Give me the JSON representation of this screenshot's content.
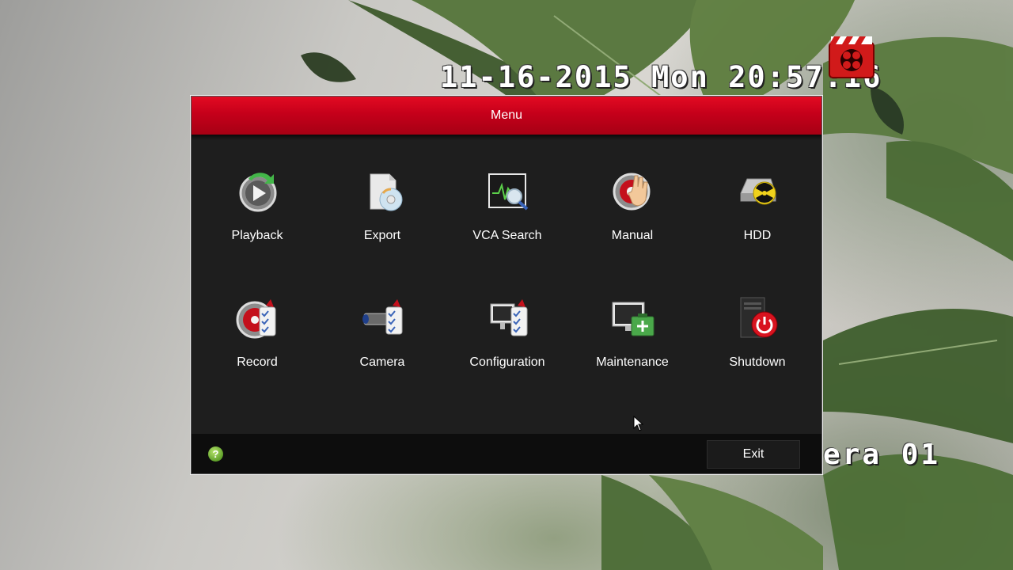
{
  "osd": {
    "datetime": "11-16-2015 Mon 20:57:16",
    "camera": "era 01"
  },
  "menu": {
    "title": "Menu",
    "items": [
      {
        "label": "Playback",
        "icon": "playback-icon"
      },
      {
        "label": "Export",
        "icon": "export-icon"
      },
      {
        "label": "VCA Search",
        "icon": "vca-search-icon"
      },
      {
        "label": "Manual",
        "icon": "manual-icon"
      },
      {
        "label": "HDD",
        "icon": "hdd-icon"
      },
      {
        "label": "Record",
        "icon": "record-icon"
      },
      {
        "label": "Camera",
        "icon": "camera-icon"
      },
      {
        "label": "Configuration",
        "icon": "configuration-icon"
      },
      {
        "label": "Maintenance",
        "icon": "maintenance-icon"
      },
      {
        "label": "Shutdown",
        "icon": "shutdown-icon"
      }
    ],
    "help_glyph": "?",
    "exit_label": "Exit"
  },
  "colors": {
    "titlebar": "#c5001a",
    "dialog_bg": "#1e1e1e",
    "footer_bg": "#0d0d0d",
    "text": "#ffffff"
  }
}
